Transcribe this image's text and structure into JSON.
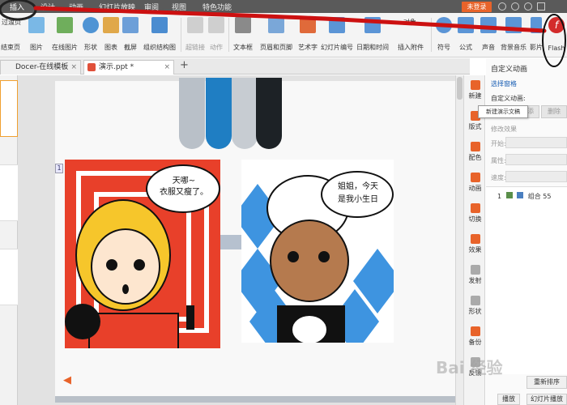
{
  "menubar": {
    "items": [
      "插入",
      "设计",
      "动画",
      "幻灯片放映",
      "审阅",
      "视图",
      "特色功能"
    ],
    "unregistered": "未登录"
  },
  "ribbon": {
    "items": [
      "结束页",
      "图片",
      "在线图片",
      "形状",
      "图表",
      "截屏",
      "组织结构图",
      "超链接",
      "动作",
      "文本框",
      "页眉和页脚",
      "艺术字",
      "幻灯片编号",
      "日期和时间",
      "插入附件",
      "符号",
      "公式",
      "声音",
      "背景音乐",
      "影片",
      "Flash"
    ],
    "small_top": "过渡页",
    "small_object": "对象"
  },
  "tabs": [
    {
      "label": "Docer-在线模板"
    },
    {
      "label": "演示.ppt *"
    }
  ],
  "add_tab": "+",
  "slide": {
    "number": "1",
    "bubble_left": [
      "天哪~",
      "衣服又瘦了。"
    ],
    "bubble_right": [
      "姐姐，今天",
      "是我小生日"
    ]
  },
  "iconcol": [
    "新建",
    "版式",
    "配色",
    "动画",
    "切换",
    "效果",
    "发射",
    "形状",
    "备份",
    "反馈"
  ],
  "panel": {
    "title": "自定义动画",
    "select_pane": "选择窗格",
    "custom_anim_label": "自定义动画:",
    "add_effect": "添",
    "delete": "删除",
    "modify": "修改效果",
    "start": "开始:",
    "property": "属性:",
    "speed": "速度:",
    "list_item_num": "1",
    "list_item_label": "组合 55",
    "reorder": "重新排序",
    "play": "播放",
    "slideshow": "幻灯片播放"
  },
  "tooltip": "新建演示文稿",
  "watermark": "Bai 经验",
  "colors": {
    "menubar": "#5a5a5a",
    "unregistered": "#e8632a",
    "annotation": "#cc1111",
    "panel_red": "#e53935",
    "bubble_red": "#e8402a",
    "blue": "#2f7fd1"
  }
}
